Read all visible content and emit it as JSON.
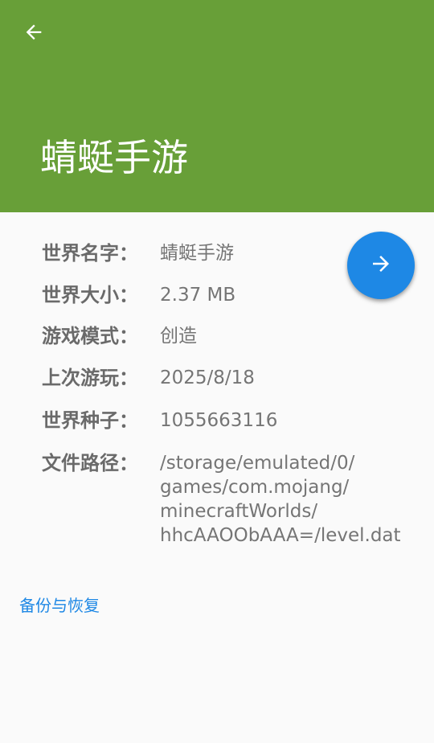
{
  "header": {
    "back_icon": "arrow-left-icon",
    "title": "蜻蜓手游"
  },
  "fab": {
    "icon": "arrow-right-icon",
    "color": "#1e88e5"
  },
  "theme": {
    "app_bar_color": "#689f38",
    "link_color": "#1e88e5"
  },
  "info": [
    {
      "label": "世界名字：",
      "value": "蜻蜓手游"
    },
    {
      "label": "世界大小：",
      "value": "2.37 MB"
    },
    {
      "label": "游戏模式：",
      "value": "创造"
    },
    {
      "label": "上次游玩：",
      "value": "2025/8/18"
    },
    {
      "label": "世界种子：",
      "value": "1055663116"
    },
    {
      "label": "文件路径：",
      "value": "/storage/emulated/0/\ngames/com.mojang/\nminecraftWorlds/\nhhcAAOObAAA=/level.dat"
    }
  ],
  "backup_link": "备份与恢复"
}
